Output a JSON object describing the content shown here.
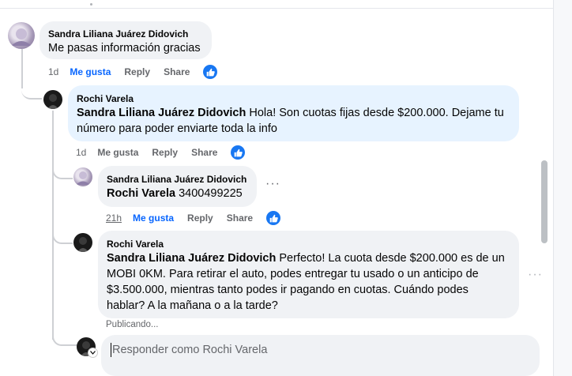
{
  "comments": [
    {
      "author": "Sandra Liliana Juárez Didovich",
      "text": "Me pasas información gracias",
      "time": "1d",
      "like": "Me gusta",
      "reply": "Reply",
      "share": "Share"
    },
    {
      "author": "Rochi Varela",
      "mention": "Sandra Liliana Juárez Didovich",
      "text_line1": " Hola! Son cuotas fijas desde $200.000. Dejame tu",
      "text_line2": "número para poder enviarte toda la info",
      "time": "1d",
      "like": "Me gusta",
      "reply": "Reply",
      "share": "Share"
    },
    {
      "author": "Sandra Liliana Juárez Didovich",
      "mention": "Rochi Varela",
      "text": " 3400499225",
      "time": "21h",
      "like": "Me gusta",
      "reply": "Reply",
      "share": "Share"
    },
    {
      "author": "Rochi Varela",
      "mention": "Sandra Liliana Juárez Didovich",
      "text_line1": " Perfecto! La cuota desde $200.000 es de un",
      "text_line2": "MOBI 0KM. Para retirar el auto, podes entregar tu usado o un anticipo de",
      "text_line3": "$3.500.000, mientras tanto podes ir pagando en cuotas. Cuándo podes",
      "text_line4": "hablar? A la mañana o a la tarde?",
      "status": "Publicando..."
    }
  ],
  "reply_box": {
    "placeholder": "Responder como Rochi Varela"
  },
  "colors": {
    "accent": "#0866ff",
    "like_badge": "#1877f2",
    "bubble": "#f0f2f5",
    "bubble_highlight": "#e7f3ff"
  },
  "icons": [
    "like-badge-icon",
    "more-options-icon",
    "chevron-down-icon"
  ]
}
